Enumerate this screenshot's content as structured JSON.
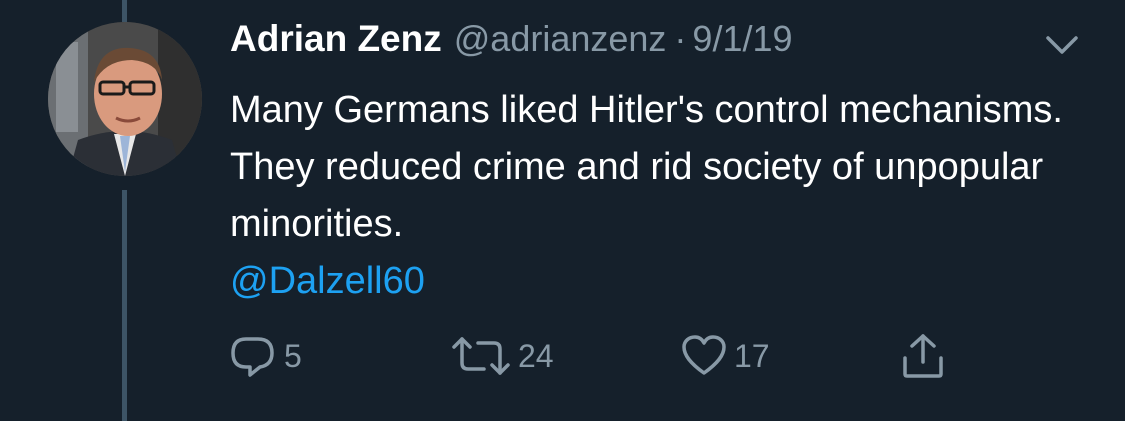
{
  "tweet": {
    "author_name": "Adrian Zenz",
    "handle": "@adrianzenz",
    "separator": "·",
    "date": "9/1/19",
    "text": "Many Germans liked Hitler's control mechanisms. They reduced crime and rid society of unpopular minorities.",
    "mention": "@Dalzell60"
  },
  "actions": {
    "reply_count": "5",
    "retweet_count": "24",
    "like_count": "17"
  },
  "icons": {
    "reply": "reply-icon",
    "retweet": "retweet-icon",
    "like": "heart-icon",
    "share": "share-icon",
    "menu": "chevron-down-icon"
  },
  "colors": {
    "background": "#15202b",
    "text": "#ffffff",
    "secondary": "#8899a6",
    "link": "#1da1f2",
    "thread_line": "#3d5466"
  }
}
